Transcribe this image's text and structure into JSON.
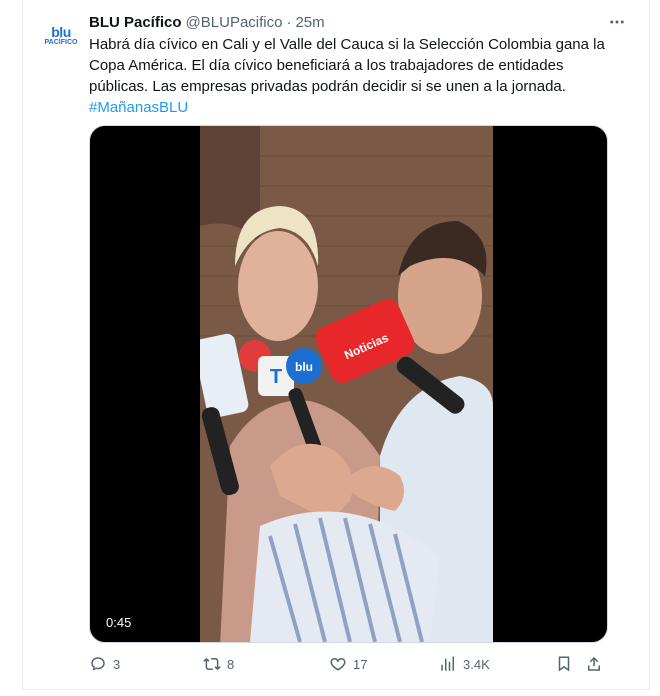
{
  "tweet": {
    "avatar": {
      "line1": "blu",
      "line2": "PACÍFICO",
      "icon": "blu-pacifico-logo-icon"
    },
    "author_name": "BLU Pacífico",
    "handle": "@BLUPacifico",
    "separator": "·",
    "time": "25m",
    "text": "Habrá día cívico en Cali y el Valle del Cauca si la Selección Colombia gana la Copa América. El día cívico beneficiará a los trabajadores de entidades públicas. Las empresas privadas podrán decidir si se unen a la jornada.",
    "hashtag": "#MañanasBLU",
    "video": {
      "duration": "0:45",
      "mic_labels": {
        "mic_a": "T",
        "mic_b": "blu",
        "mic_c": "Noticias"
      }
    },
    "actions": {
      "replies": "3",
      "reposts": "8",
      "likes": "17",
      "views": "3.4K"
    },
    "colors": {
      "link": "#1d9bf0",
      "secondary": "#536471",
      "brand": "#1c6fd1"
    }
  }
}
